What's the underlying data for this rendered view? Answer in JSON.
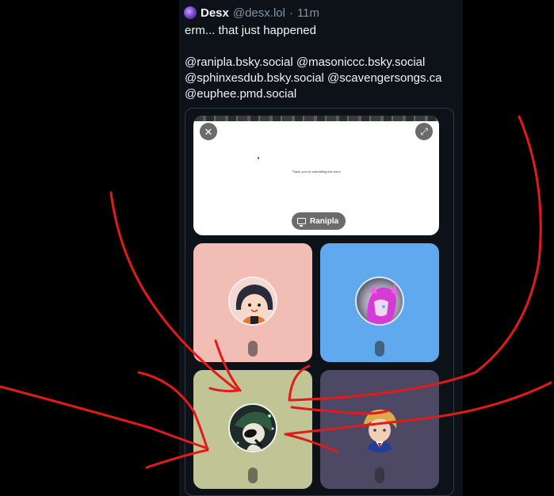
{
  "post": {
    "author_name": "Desx",
    "author_handle": "@desx.lol",
    "separator": "·",
    "timestamp": "11m",
    "text_line1": "erm... that just happened",
    "mentions": [
      "@ranipla.bsky.social",
      "@masoniccc.bsky.social",
      "@sphinxesdub.bsky.social",
      "@scavengersongs.ca",
      "@euphee.pmd.social"
    ]
  },
  "call": {
    "screen_share": {
      "message": "Thank you for submitting this form!",
      "sharer_label": "Ranipla",
      "close_icon": "close-icon",
      "expand_icon": "expand-icon",
      "share_icon": "monitor-icon"
    },
    "tiles": [
      {
        "bg": "#f2bdb5",
        "icon": "microphone-icon"
      },
      {
        "bg": "#61a9ef",
        "icon": "microphone-icon"
      },
      {
        "bg": "#c1c495",
        "icon": "microphone-icon"
      },
      {
        "bg": "#4d4864",
        "icon": "microphone-icon"
      }
    ]
  },
  "annotation": {
    "stroke_color": "#e21a1a"
  }
}
